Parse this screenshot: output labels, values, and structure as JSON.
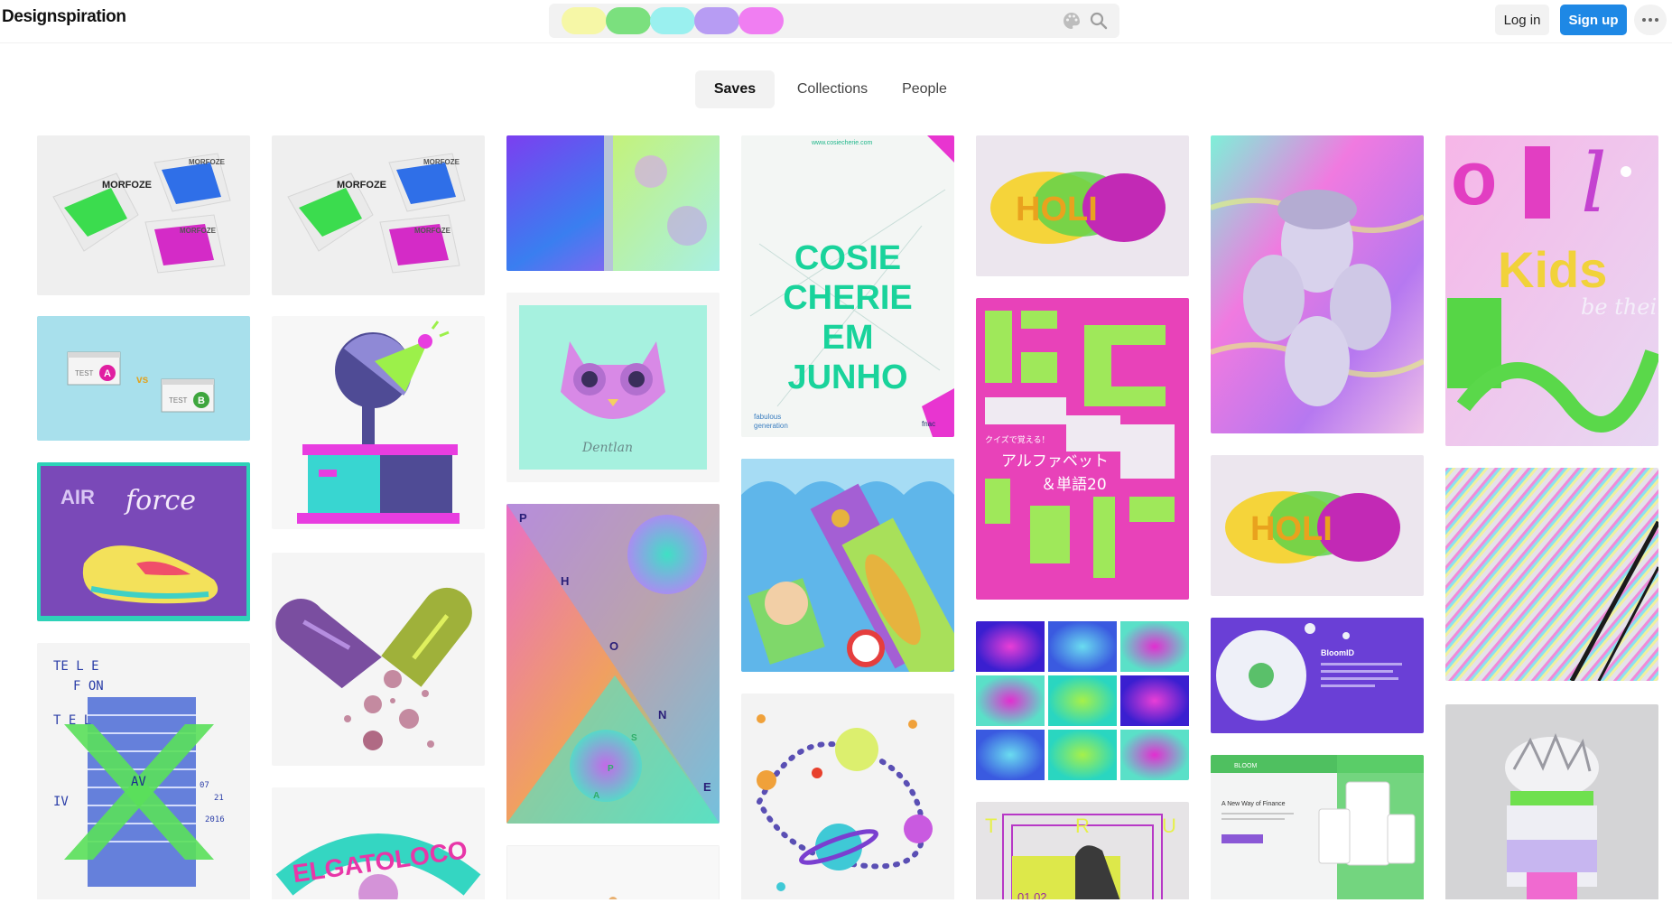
{
  "app": {
    "title": "Designspiration"
  },
  "search": {
    "swatches": [
      {
        "name": "yellow",
        "color": "#f6f7a6"
      },
      {
        "name": "green",
        "color": "#7be07e"
      },
      {
        "name": "cyan",
        "color": "#9af0ef"
      },
      {
        "name": "violet",
        "color": "#b79cf3"
      },
      {
        "name": "pink",
        "color": "#f07ef2"
      }
    ],
    "icons": [
      "palette-icon",
      "search-icon"
    ]
  },
  "header": {
    "login_label": "Log in",
    "signup_label": "Sign up",
    "more_icon": "more-dots-icon"
  },
  "tabs": [
    {
      "label": "Saves",
      "active": true
    },
    {
      "label": "Collections",
      "active": false
    },
    {
      "label": "People",
      "active": false
    }
  ],
  "colors": {
    "accent": "#1e88e5",
    "tab_bg": "#f2f2f2",
    "background": "#ffffff"
  },
  "cards": {
    "morfoze_1": {
      "text_1": "MORFOZE",
      "text_2": "MORFOZE",
      "text_3": "MORFOZE"
    },
    "morfoze_2": {
      "text_1": "MORFOZE",
      "text_2": "MORFOZE",
      "text_3": "MORFOZE"
    },
    "ab_test": {
      "label_a": "TEST",
      "badge_a": "A",
      "vs": "vs",
      "label_b": "TEST",
      "badge_b": "B"
    },
    "air_force": {
      "text": "AIR",
      "script": "force"
    },
    "telefon": {
      "line_1": "TE L E",
      "line_2": "F ON",
      "line_3": "T E L",
      "line_4": "AV",
      "line_5": "IV",
      "date_1": "07",
      "date_2": "21",
      "date_3": "2016"
    },
    "elgatoloco": {
      "text": "ELGATOLOCO"
    },
    "cat": {
      "signature": "Dentlan"
    },
    "phone": {
      "l1": "P",
      "l2": "H",
      "l3": "O",
      "l4": "N",
      "l5": "E",
      "l6": "S",
      "l7": "P",
      "l8": "A"
    },
    "cosie": {
      "url": "www.cosiecherie.com",
      "title_1": "COSIE",
      "title_2": "CHERIE",
      "title_3": "EM",
      "title_4": "JUNHO",
      "footer_1": "fabulous",
      "footer_2": "generation",
      "footer_3": "fnac"
    },
    "holi_1": {
      "text": "HOLI"
    },
    "holi_2": {
      "text": "HOLI"
    },
    "abc_jp": {
      "jp_1": "クイズで覚える！",
      "jp_2": "アルファベット",
      "jp_3": "＆単語20"
    },
    "taurus": {
      "l1": "T",
      "l2": "R",
      "l3": "U",
      "date": "01.02"
    },
    "bloom": {
      "title": "BloomID"
    },
    "finance": {
      "brand": "BLOOM",
      "headline": "A New Way of Finance"
    },
    "kids": {
      "text": "Kids",
      "script": "be their"
    }
  }
}
